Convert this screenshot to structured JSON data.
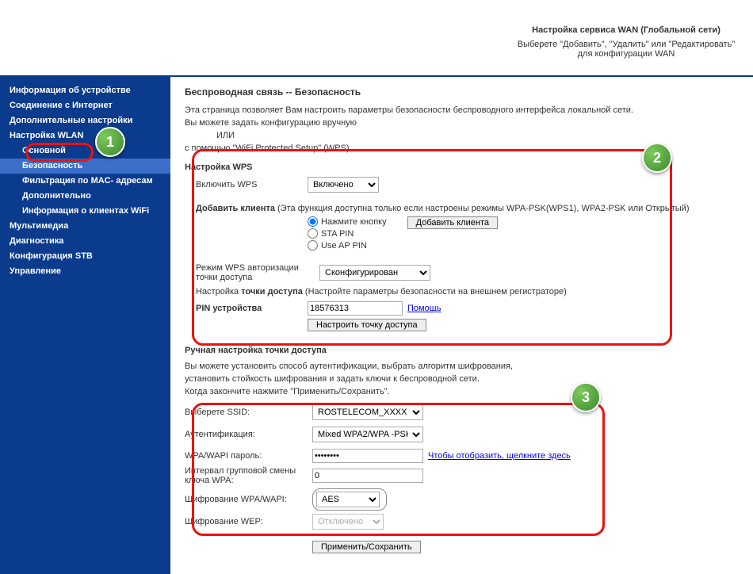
{
  "header": {
    "title": "Настройка сервиса WAN (Глобальной сети)",
    "subtitle": "Выберете \"Добавить\", \"Удалить\" или \"Редактировать\" для конфигурации WAN"
  },
  "sidebar": {
    "items": [
      "Информация об устройстве",
      "Соединение с Интернет",
      "Дополнительные настройки",
      "Настройка WLAN",
      "Основной",
      "Безопасность",
      "Фильтрация по MAC- адресам",
      "Дополнительно",
      "Информация о клиентах WiFi",
      "Мультимедиа",
      "Диагностика",
      "Конфигурация STB",
      "Управление"
    ]
  },
  "main": {
    "title": "Беспроводная связь -- Безопасность",
    "desc1": "Эта страница позволяет Вам настроить параметры безопасности беспроводного интерфейса локальной сети.",
    "desc2": "Вы можете задать конфигурацию вручную",
    "desc2b": "ИЛИ",
    "desc3": "с помощью \"WiFi Protected Setup\" (WPS)"
  },
  "wps": {
    "heading": "Настройка WPS",
    "enable_label": "Включить WPS",
    "enable_value": "Включено",
    "add_client_label": "Добавить клиента",
    "add_client_note": " (Эта функция доступна только если настроены режимы WPA-PSK(WPS1), WPA2-PSK или Открытый)",
    "radio_push": "Нажмите кнопку",
    "radio_sta": "STA PIN",
    "radio_ap": "Use AP PIN",
    "add_client_btn": "Добавить клиента",
    "mode_label": "Режим WPS авторизации точки доступа",
    "mode_value": "Сконфигурирован",
    "ap_note_bold": "Настройка точки доступа",
    "ap_note_rest": " (Настройте параметры безопасности на внешнем регистраторе)",
    "pin_label": "PIN устройства",
    "pin_value": "18576313",
    "pin_help": "Помощь",
    "configure_ap_btn": "Настроить точку доступа"
  },
  "manual": {
    "heading": "Ручная настройка точки доступа",
    "desc1": "Вы можете установить способ аутентификации, выбрать алгоритм шифрования,",
    "desc2": "установить стойкость шифрования и задать ключи к беспроводной сети.",
    "desc3": "Когда закончите нажмите \"Применить/Сохранить\".",
    "ssid_label": "Выберете SSID:",
    "ssid_value": "ROSTELECOM_XXXX",
    "auth_label": "Аутентификация:",
    "auth_value": "Mixed WPA2/WPA -PSK",
    "pass_label": "WPA/WAPI пароль:",
    "pass_value": "••••••••",
    "pass_link": "Чтобы отобразить, щелкните здесь",
    "interval_label": "Интервал групповой смены ключа WPA:",
    "interval_value": "0",
    "enc_wpa_label": "Шифрование WPA/WAPI:",
    "enc_wpa_value": "AES",
    "enc_wep_label": "Шифрование WEP:",
    "enc_wep_value": "Отключено",
    "save_btn": "Применить/Сохранить"
  },
  "callouts": {
    "n1": "1",
    "n2": "2",
    "n3": "3"
  }
}
